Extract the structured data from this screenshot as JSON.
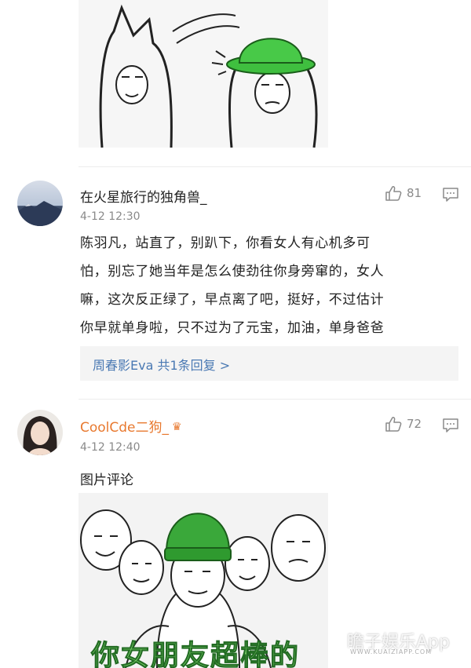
{
  "comments": [
    {
      "username": "在火星旅行的独角兽_",
      "timestamp": "4-12 12:30",
      "likes": "81",
      "body_lines": [
        "陈羽凡，站直了，别趴下，你看女人有心机多可",
        "怕，别忘了她当年是怎么使劲往你身旁窜的，女人",
        "嘛，这次反正绿了，早点离了吧，挺好，不过估计",
        "你早就单身啦，只不过为了元宝，加油，单身爸爸"
      ],
      "reply_summary": "周春影Eva  共1条回复 >"
    },
    {
      "username": "CoolCde二狗_",
      "timestamp": "4-12 12:40",
      "likes": "72",
      "body": "图片评论",
      "image_caption": "你女朋友超棒的"
    }
  ],
  "watermark": {
    "text": "瞻子娱乐App",
    "sub": "WWW.KUAIZIAPP.COM"
  },
  "colors": {
    "username_vip": "#e8792f",
    "link": "#4a79b3",
    "meta": "#8a8a8a"
  },
  "icons": [
    "thumbs-up-icon",
    "comment-icon",
    "vip-badge-icon"
  ]
}
